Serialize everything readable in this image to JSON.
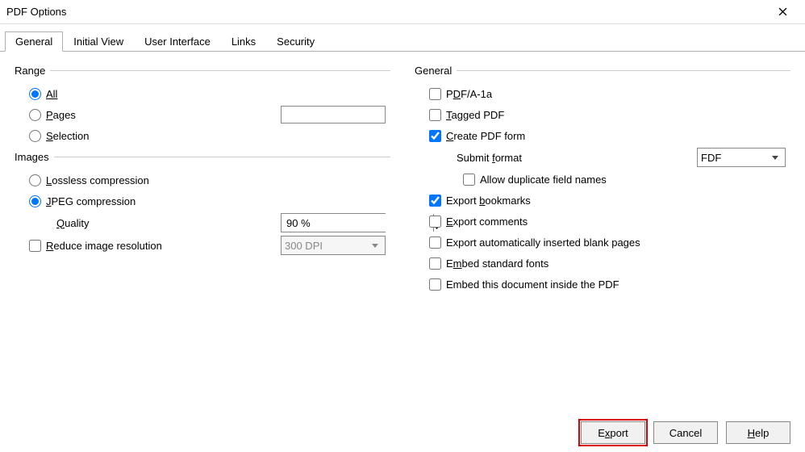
{
  "window": {
    "title": "PDF Options"
  },
  "tabs": [
    "General",
    "Initial View",
    "User Interface",
    "Links",
    "Security"
  ],
  "left": {
    "range": {
      "header": "Range",
      "all": "All",
      "pages": "Pages",
      "pages_value": "",
      "selection": "Selection"
    },
    "images": {
      "header": "Images",
      "lossless": "Lossless compression",
      "jpeg": "JPEG compression",
      "quality_label": "Quality",
      "quality_value": "90 %",
      "reduce": "Reduce image resolution",
      "dpi_value": "300 DPI"
    }
  },
  "right": {
    "header": "General",
    "pdfa": "PDF/A-1a",
    "tagged": "Tagged PDF",
    "create_form": "Create PDF form",
    "submit_format_label": "Submit format",
    "submit_format_value": "FDF",
    "allow_dup": "Allow duplicate field names",
    "bookmarks": "Export bookmarks",
    "comments": "Export comments",
    "blank_pages": "Export automatically inserted blank pages",
    "embed_std": "Embed standard fonts",
    "embed_doc": "Embed this document inside the PDF"
  },
  "buttons": {
    "export": "Export",
    "cancel": "Cancel",
    "help": "Help"
  }
}
